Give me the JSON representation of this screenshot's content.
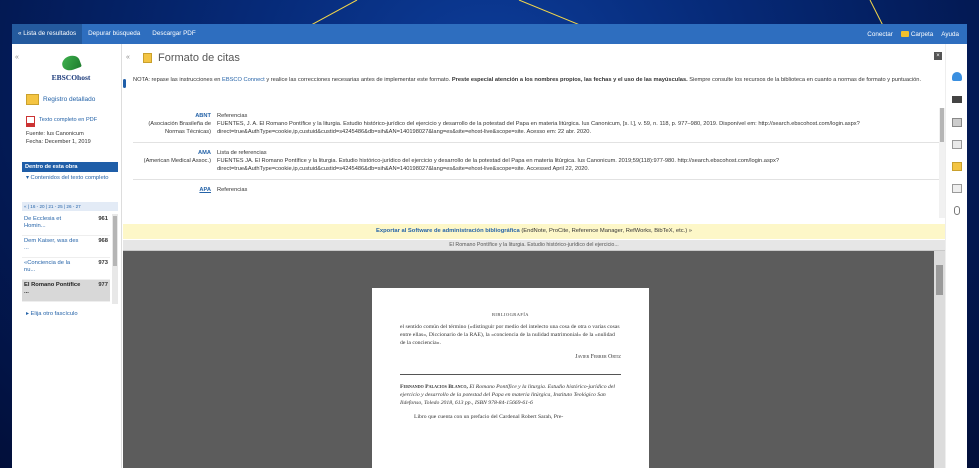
{
  "topbar": {
    "nav": [
      "« Lista de resultados",
      "Depurar búsqueda",
      "Descargar PDF"
    ],
    "conectar": "Conectar",
    "carpeta": "Carpeta",
    "ayuda": "Ayuda"
  },
  "sidebar": {
    "logo_text": "EBSCOhost",
    "registro": "Registro detallado",
    "pdf_link": "Texto completo en PDF",
    "fuente": "Fuente: Ius Canonicum",
    "fecha": "Fecha: December 1, 2019",
    "destro": "Dentro de esta obra",
    "contenidos": "▾ Contenidos del texto completo",
    "pager": "« | 16 - 20 | 21 - 25 | 26 - 27",
    "toc": [
      {
        "title": "De Ecclesia et Homin...",
        "page": "961"
      },
      {
        "title": "Dem Kaiser, was des ...",
        "page": "968"
      },
      {
        "title": "«Conciencia de la nu...",
        "page": "973"
      },
      {
        "title": "El Romano Pontífice ...",
        "page": "977"
      }
    ],
    "elija": "▸ Elija otro fascículo"
  },
  "main": {
    "title": "Formato de citas",
    "note_pre": "NOTA: repase las instrucciones en ",
    "note_link": "EBSCO Connect",
    "note_mid": " y realice las correcciones necesarias antes de implementar este formato. ",
    "note_bold": "Preste especial atención a los nombres propios, las fechas y el uso de las mayúsculas.",
    "note_post": " Siempre consulte los recursos de la biblioteca en cuanto a normas de formato y puntuación.",
    "citations": [
      {
        "style": "ABNT",
        "style_desc": "(Asociación Brasileña de Normas Técnicas)",
        "heading": "Referencias",
        "text": "FUENTES, J. A. El Romano Pontífice y la liturgia. Estudio histórico-jurídico del ejercicio y desarrollo de la potestad del Papa en materia litúrgica. Ius Canonicum, [s. l.], v. 59, n. 118, p. 977–980, 2019. Disponível em: http://search.ebscohost.com/login.aspx?direct=true&AuthType=cookie,ip,custuid&custid=s4245486&db=sih&AN=140198027&lang=es&site=ehost-live&scope=site. Acesso em: 22 abr. 2020."
      },
      {
        "style": "AMA",
        "style_desc": "(American Medical Assoc.)",
        "heading": "Lista de referencias",
        "text": "FUENTES JA. El Romano Pontífice y la liturgia. Estudio histórico-jurídico del ejercicio y desarrollo de la potestad del Papa en materia litúrgica. Ius Canonicum. 2019;59(118):977-980. http://search.ebscohost.com/login.aspx?direct=true&AuthType=cookie,ip,custuid&custid=s4245486&db=sih&AN=140198027&lang=es&site=ehost-live&scope=site. Accessed April 22, 2020."
      },
      {
        "style": "APA",
        "style_desc": "",
        "heading": "Referencias",
        "text": ""
      }
    ],
    "export_link": "Exportar al Software de administración bibliográfica",
    "export_rest": " (EndNote, ProCite, Reference Manager, RefWorks, BibTeX, etc.) »",
    "viewer_title": "El Romano Pontífice y la liturgia. Estudio histórico-jurídico del ejercicio...",
    "page": {
      "bib": "BIBLIOGRAFÍA",
      "para1": "el sentido común del término («distinguir por medio del intelecto una cosa de otra o varias cosas entre ellas», Diccionario de la RAE), la «conciencia de la nulidad matrimonial» de la «nulidad de la conciencia».",
      "signature": "Javier Ferrer Ortiz",
      "ref_author": "Fernando Palacios Blanco,",
      "ref_text": " El Romano Pontífice y la liturgia. Estudio histórico-jurídico del ejercicio y desarrollo de la potestad del Papa en materia litúrgica, Instituto Teológico San Ildefonso, Toledo 2018, 613 pp., ISBN 978-84-15669-61-6",
      "para2": "Libro que cuenta con un prefacio del Cardenal Robert Sarah, Pre-"
    }
  },
  "colors": {
    "nav_bar": "#2e6ebf",
    "accent_link": "#2563a8",
    "export_bg": "#fdf7c8",
    "annotation": "#f3d64a"
  }
}
